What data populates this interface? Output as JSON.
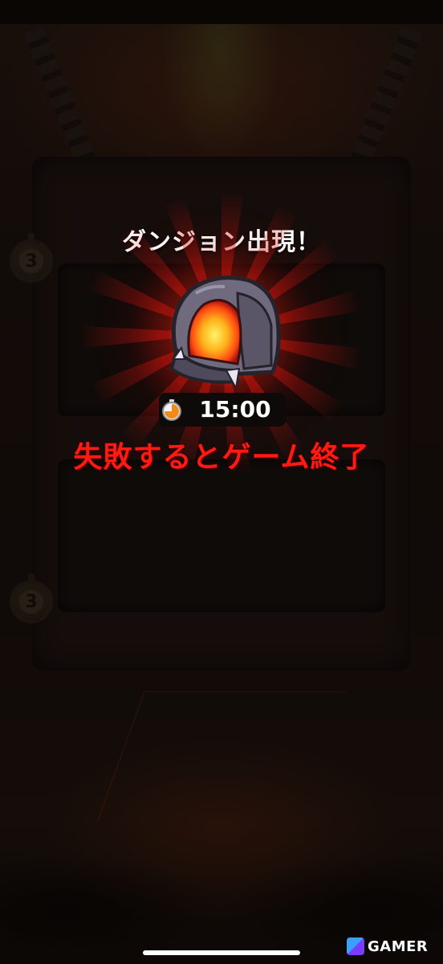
{
  "dungeon_popup": {
    "title": "ダンジョン出現！",
    "timer": "15:00",
    "warning": "失敗するとゲーム終了"
  },
  "background": {
    "timer_tokens": [
      "3",
      "3"
    ]
  },
  "watermark": {
    "text": "GAMER"
  },
  "icons": {
    "dungeon": "cave-dungeon-icon",
    "stopwatch": "stopwatch-icon"
  },
  "colors": {
    "warning": "#ff1a12",
    "burst": "#d2140f",
    "title": "#ffffff"
  }
}
